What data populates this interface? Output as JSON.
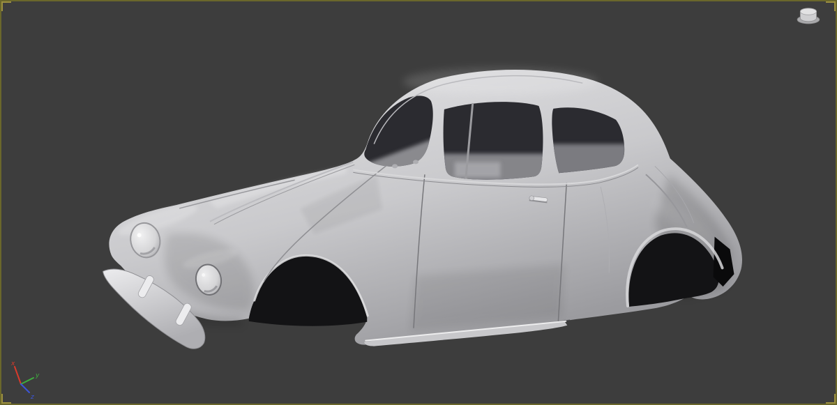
{
  "viewport": {
    "type": "3d-perspective-viewport",
    "background_color": "#3d3d3d",
    "border_color": "#6b672b",
    "corner_accent_color": "#9c9040"
  },
  "scene": {
    "model": {
      "name": "VW Beetle body shell",
      "shading": "clay gray",
      "body_highlight_color": "#e6e6e8",
      "body_color": "#c9c9cc",
      "body_shadow_color": "#9b9b9f",
      "window_color": "#2b2b30",
      "wheel_arch_color": "#131315"
    }
  },
  "gizmos": {
    "world_axis": {
      "x_label": "x",
      "y_label": "y",
      "z_label": "z",
      "x_color": "#d93a2b",
      "y_color": "#3fae3f",
      "z_color": "#3c55d9"
    },
    "viewcube": {
      "fill_color": "#cfcfd1"
    }
  }
}
